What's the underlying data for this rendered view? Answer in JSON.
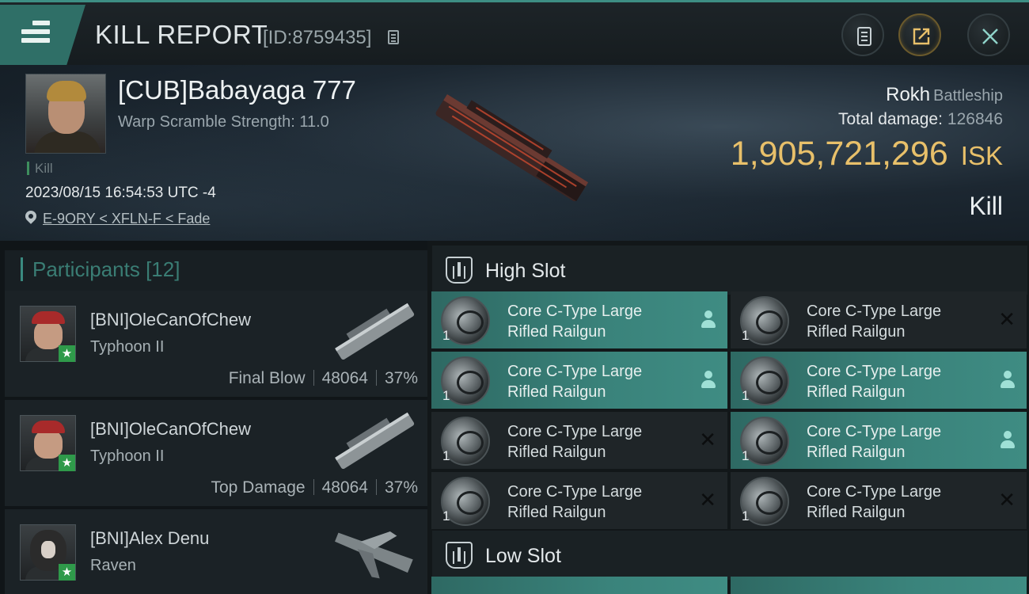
{
  "topbar": {
    "title": "KILL REPORT",
    "kill_id": "[ID:8759435]"
  },
  "victim": {
    "name": "[CUB]Babayaga 777",
    "warp_scramble": "Warp Scramble Strength: 11.0",
    "kill_tag": "Kill",
    "datetime": "2023/08/15 16:54:53 UTC -4",
    "location": "E-9ORY < XFLN-F < Fade",
    "ship_name": "Rokh",
    "ship_class": "Battleship",
    "total_damage_label": "Total damage:",
    "total_damage": "126846",
    "isk_value": "1,905,721,296",
    "isk_unit": "ISK",
    "report_type": "Kill"
  },
  "participants": {
    "title": "Participants",
    "count": "[12]",
    "rows": [
      {
        "name": "[BNI]OleCanOfChew",
        "ship": "Typhoon II",
        "role": "Final Blow",
        "damage": "48064",
        "percent": "37%"
      },
      {
        "name": "[BNI]OleCanOfChew",
        "ship": "Typhoon II",
        "role": "Top Damage",
        "damage": "48064",
        "percent": "37%"
      },
      {
        "name": "[BNI]Alex Denu",
        "ship": "Raven",
        "role": "",
        "damage": "",
        "percent": ""
      }
    ]
  },
  "slots": {
    "high_label": "High Slot",
    "low_label": "Low Slot",
    "high_modules": [
      {
        "name": "Core C-Type Large Rifled Railgun",
        "qty": "1",
        "state": "dropped",
        "status_icon": "person-icon"
      },
      {
        "name": "Core C-Type Large Rifled Railgun",
        "qty": "1",
        "state": "destroyed",
        "status_icon": "x-icon"
      },
      {
        "name": "Core C-Type Large Rifled Railgun",
        "qty": "1",
        "state": "dropped",
        "status_icon": "person-icon"
      },
      {
        "name": "Core C-Type Large Rifled Railgun",
        "qty": "1",
        "state": "dropped",
        "status_icon": "person-icon"
      },
      {
        "name": "Core C-Type Large Rifled Railgun",
        "qty": "1",
        "state": "destroyed",
        "status_icon": "x-icon"
      },
      {
        "name": "Core C-Type Large Rifled Railgun",
        "qty": "1",
        "state": "dropped",
        "status_icon": "person-icon"
      },
      {
        "name": "Core C-Type Large Rifled Railgun",
        "qty": "1",
        "state": "destroyed",
        "status_icon": "x-icon"
      },
      {
        "name": "Core C-Type Large Rifled Railgun",
        "qty": "1",
        "state": "destroyed",
        "status_icon": "x-icon"
      }
    ]
  },
  "colors": {
    "accent": "#3f8c83",
    "isk": "#e8c06a",
    "final_blow_star": "#2f9a4a"
  }
}
